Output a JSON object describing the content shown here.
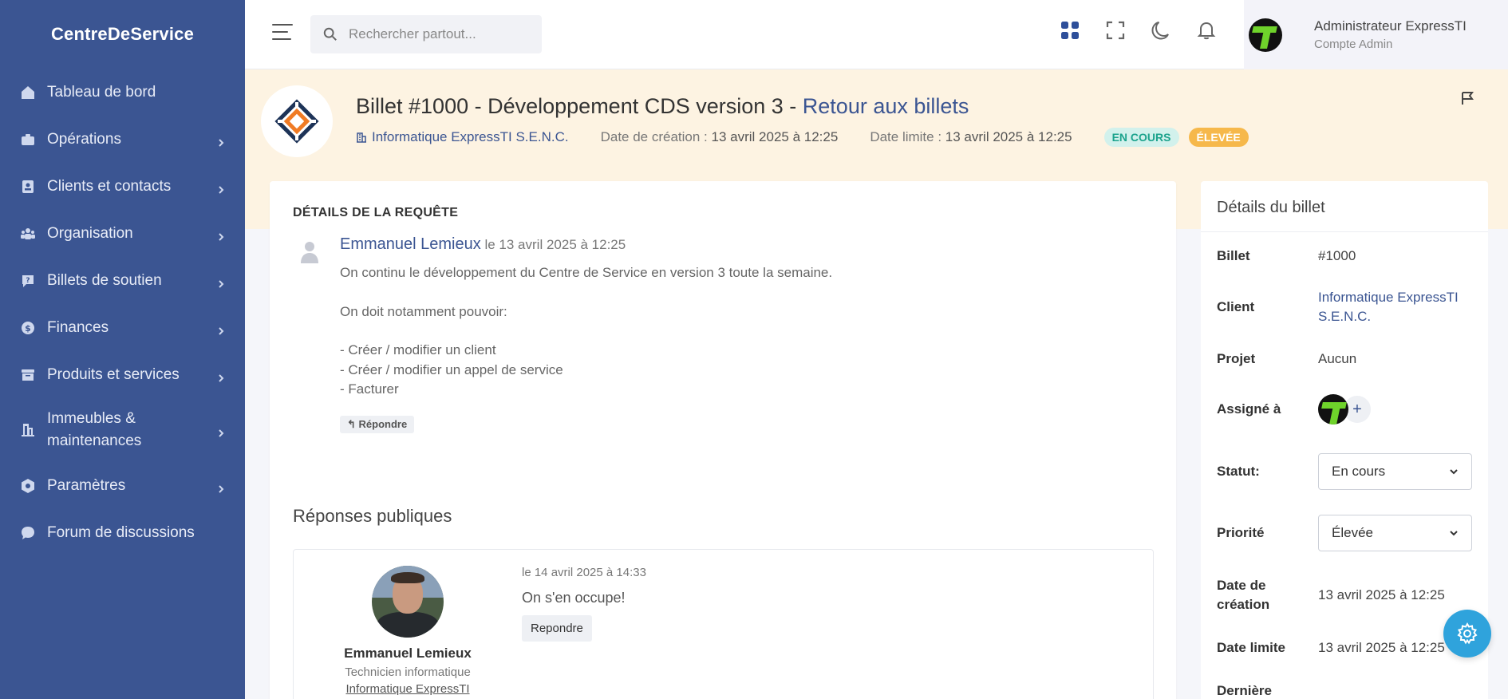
{
  "brand": "CentreDeService",
  "sidebar": {
    "items": [
      {
        "label": "Tableau de bord",
        "icon": "home-icon",
        "chevron": false
      },
      {
        "label": "Opérations",
        "icon": "briefcase-icon",
        "chevron": true
      },
      {
        "label": "Clients et contacts",
        "icon": "contact-card-icon",
        "chevron": true
      },
      {
        "label": "Organisation",
        "icon": "group-icon",
        "chevron": true
      },
      {
        "label": "Billets de soutien",
        "icon": "help-ticket-icon",
        "chevron": true
      },
      {
        "label": "Finances",
        "icon": "coin-icon",
        "chevron": true
      },
      {
        "label": "Produits et services",
        "icon": "archive-icon",
        "chevron": true
      },
      {
        "label": "Immeubles & maintenances",
        "icon": "building-icon",
        "chevron": true
      },
      {
        "label": "Paramètres",
        "icon": "settings-hex-icon",
        "chevron": true
      },
      {
        "label": "Forum de discussions",
        "icon": "chat-icon",
        "chevron": false
      }
    ]
  },
  "topbar": {
    "search_placeholder": "Rechercher partout...",
    "user_name": "Administrateur ExpressTI",
    "user_role": "Compte Admin",
    "icons": [
      "apps-grid-icon",
      "fullscreen-icon",
      "moon-icon",
      "bell-icon"
    ]
  },
  "ticket": {
    "title_prefix": "Billet #1000 - Développement CDS version 3 - ",
    "back_link": "Retour aux billets",
    "company": "Informatique ExpressTI S.E.N.C.",
    "created_label": "Date de création : ",
    "created_value": "13 avril 2025 à 12:25",
    "due_label": "Date limite : ",
    "due_value": "13 avril 2025 à 12:25",
    "status_badge": "EN COURS",
    "priority_badge": "ÉLEVÉE"
  },
  "request": {
    "section_title": "DÉTAILS DE LA REQUÊTE",
    "author": "Emmanuel Lemieux",
    "date": " le 13 avril 2025 à 12:25",
    "lines": [
      "On continu le développement du Centre de Service en version 3 toute la semaine.",
      "",
      "On doit notamment pouvoir:",
      "",
      "- Créer / modifier un client",
      "- Créer / modifier un appel de service",
      "- Facturer"
    ],
    "reply_label": "Répondre"
  },
  "public_replies": {
    "title": "Réponses publiques",
    "items": [
      {
        "name": "Emmanuel Lemieux",
        "role": "Technicien informatique",
        "company": "Informatique ExpressTI",
        "date": "le 14 avril 2025 à 14:33",
        "text": "On s'en occupe!",
        "reply_label": "Repondre"
      }
    ]
  },
  "details": {
    "title": "Détails du billet",
    "rows": {
      "billet_label": "Billet",
      "billet_value": "#1000",
      "client_label": "Client",
      "client_value": "Informatique ExpressTI S.E.N.C.",
      "projet_label": "Projet",
      "projet_value": "Aucun",
      "assigne_label": "Assigné à",
      "statut_label": "Statut:",
      "statut_value": "En cours",
      "priorite_label": "Priorité",
      "priorite_value": "Élevée",
      "creation_label": "Date de création",
      "creation_value": "13 avril 2025 à 12:25",
      "limite_label": "Date limite",
      "limite_value": "13 avril 2025 à 12:25",
      "derniere_label": "Dernière"
    }
  },
  "colors": {
    "sidebar_bg": "#3b5592",
    "header_bg": "#fdf3e2",
    "accent": "#3b5592",
    "status_green": "#1ca38d",
    "priority_orange": "#f6b84b",
    "fab": "#2fa3dc"
  }
}
